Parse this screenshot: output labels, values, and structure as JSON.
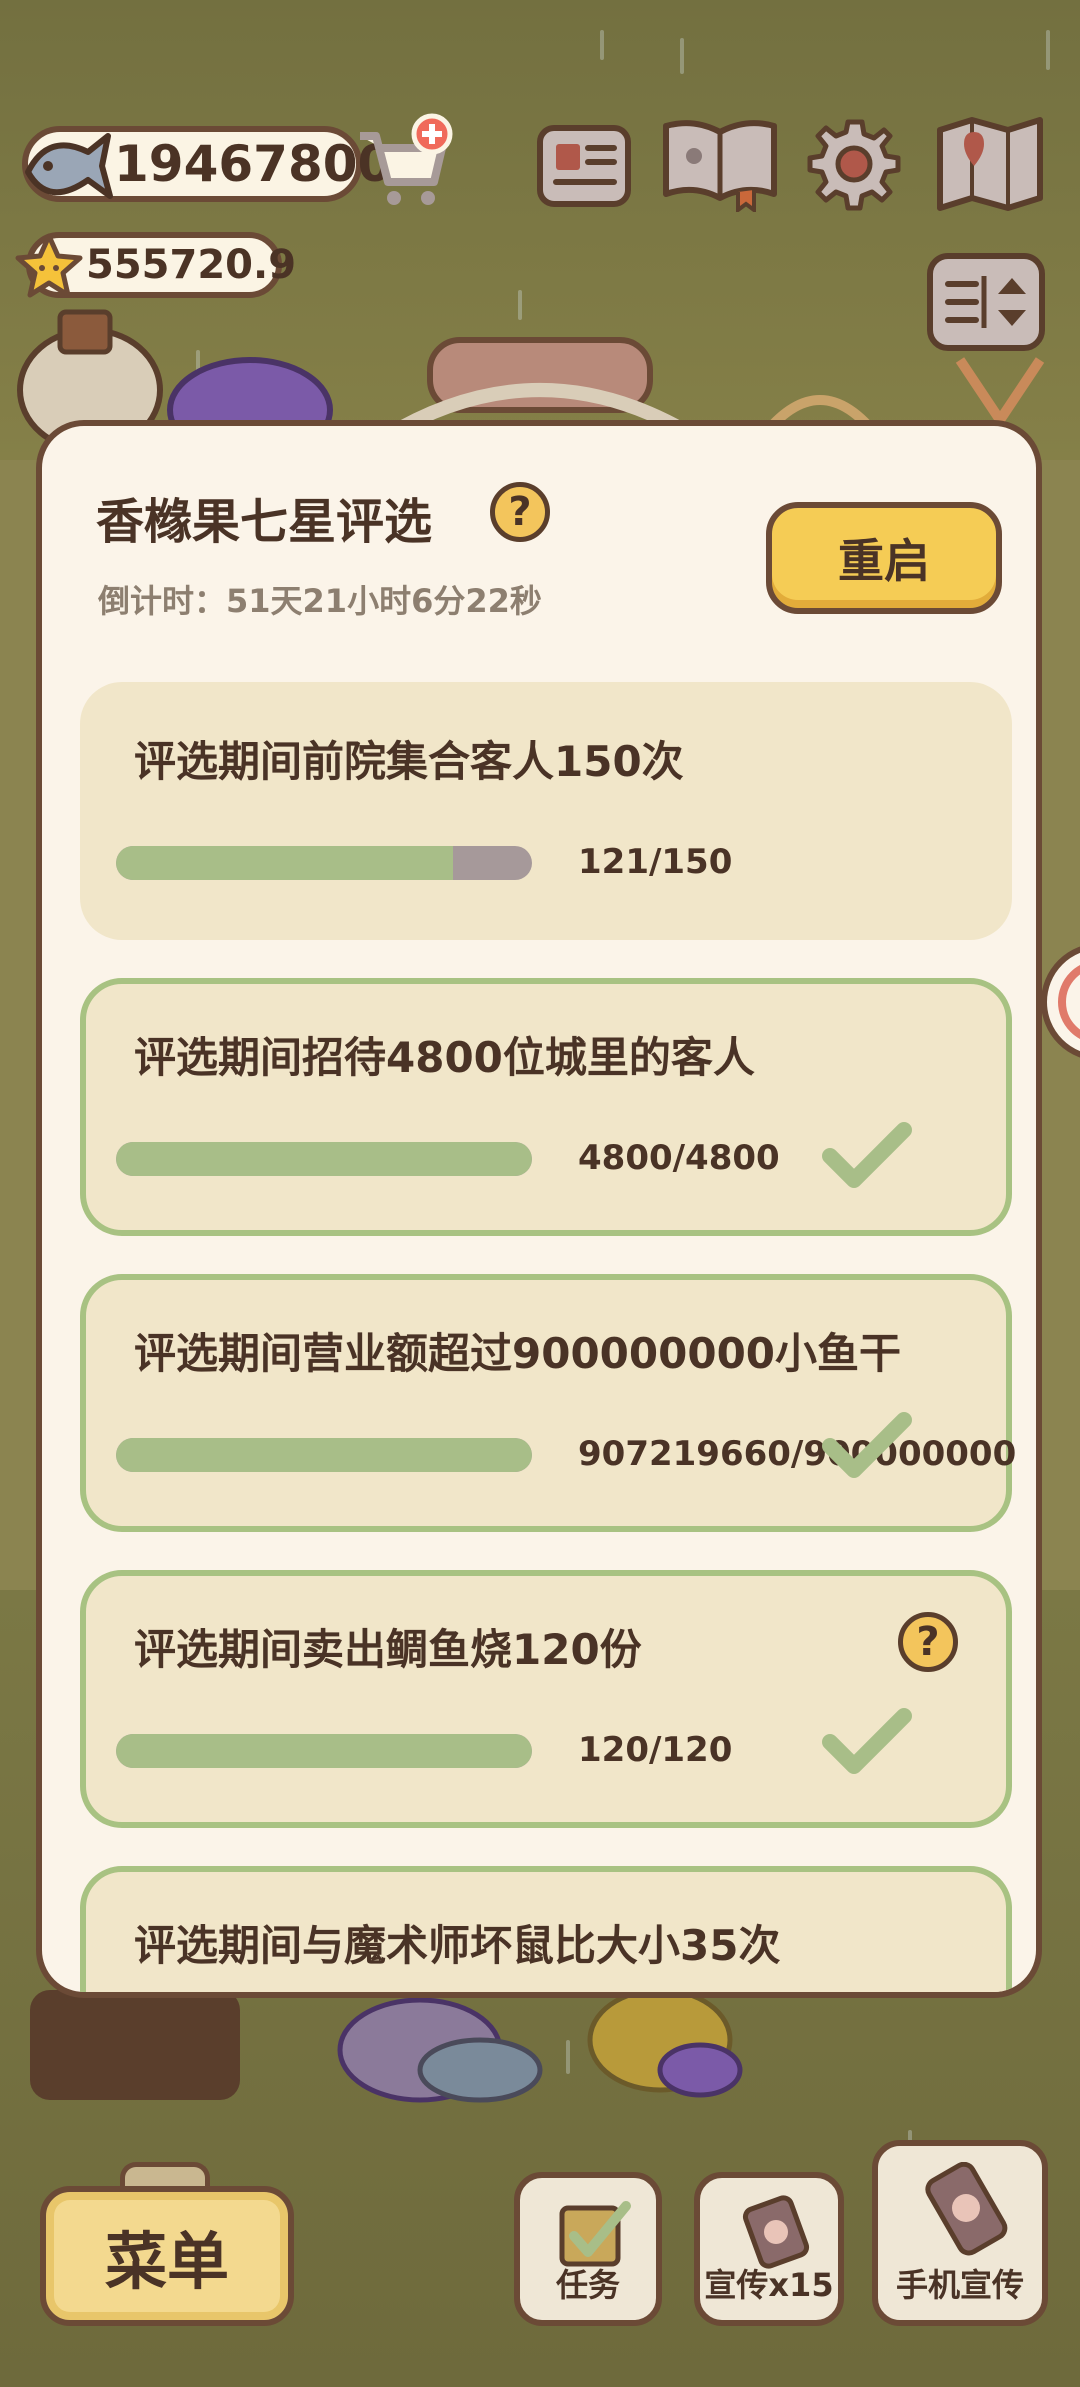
{
  "currency": {
    "fish": "19467800",
    "star": "555720.9"
  },
  "icons": {
    "fish": "fish-icon",
    "star": "star-icon",
    "cart": "cart-add-icon",
    "newspaper": "newspaper-icon",
    "book": "book-icon",
    "settings": "gear-icon",
    "map": "map-icon",
    "sort": "sort-icon"
  },
  "dialog": {
    "title": "香橼果七星评选",
    "help": "?",
    "countdown": "倒计时：51天21小时6分22秒",
    "restart_label": "重启",
    "tasks": [
      {
        "label": "评选期间前院集合客人150次",
        "progress_text": "121/150",
        "progress": 0.81,
        "done": false
      },
      {
        "label": "评选期间招待4800位城里的客人",
        "progress_text": "4800/4800",
        "progress": 1.0,
        "done": true
      },
      {
        "label": "评选期间营业额超过900000000小鱼干",
        "progress_text": "907219660/900000000",
        "progress": 1.0,
        "done": true
      },
      {
        "label": "评选期间卖出鲷鱼烧120份",
        "progress_text": "120/120",
        "progress": 1.0,
        "done": true,
        "help": "?"
      },
      {
        "label": "评选期间与魔术师坏鼠比大小35次"
      }
    ]
  },
  "bottom": {
    "menu_label": "菜单",
    "task_label": "任务",
    "promo_label": "宣传x15",
    "phone_promo_label": "手机宣传"
  },
  "colors": {
    "accent": "#f5cc55",
    "progress_fill": "#a8be88",
    "panel": "#fbf4e9",
    "border": "#6b4a36"
  }
}
